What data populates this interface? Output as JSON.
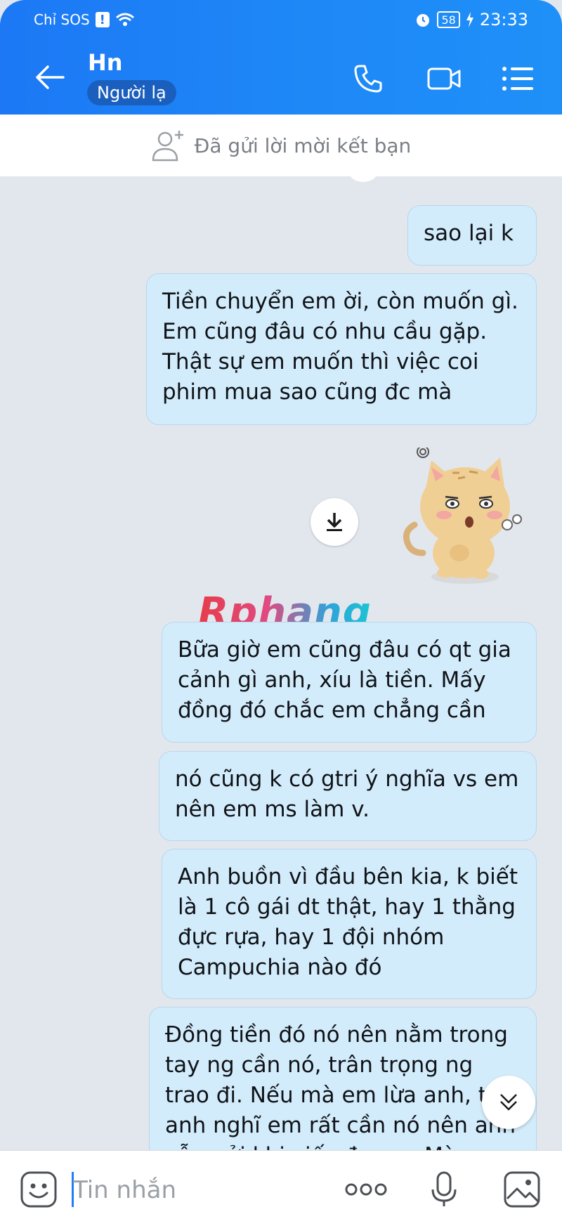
{
  "status": {
    "carrier": "Chỉ SOS",
    "battery": "58",
    "time": "23:33"
  },
  "header": {
    "title": "Hn",
    "badge": "Người lạ"
  },
  "friend_request": {
    "text": "Đã gửi lời mời kết bạn"
  },
  "messages": [
    "sao lại k",
    "Tiền chuyển em ời, còn muốn gì. Em cũng đâu có nhu cầu gặp. Thật sự em muốn thì việc coi phim mua sao cũng đc mà",
    "Bữa giờ em cũng đâu có qt gia cảnh gì anh, xíu là tiền. Mấy đồng đó chắc em chẳng cần",
    "nó cũng k có gtri ý nghĩa vs em nên em ms làm v.",
    "Anh buồn vì đầu bên kia, k biết là 1 cô gái dt thật, hay 1 thằng đực rựa, hay 1 đội nhóm Campuchia nào đó",
    "Đồng tiền đó nó nên nằm trong tay ng cần nó, trân trọng ng trao đi. Nếu mà em lừa anh, thì anh nghĩ em rất cần nó nên anh vẫn gửi khi viếc đc em. Mà"
  ],
  "watermark": "Rphang",
  "input": {
    "placeholder": "Tin nhắn"
  },
  "colors": {
    "header": "#1e87f7",
    "bubble": "#d3ecfb",
    "chat_bg": "#e2e7ee"
  }
}
